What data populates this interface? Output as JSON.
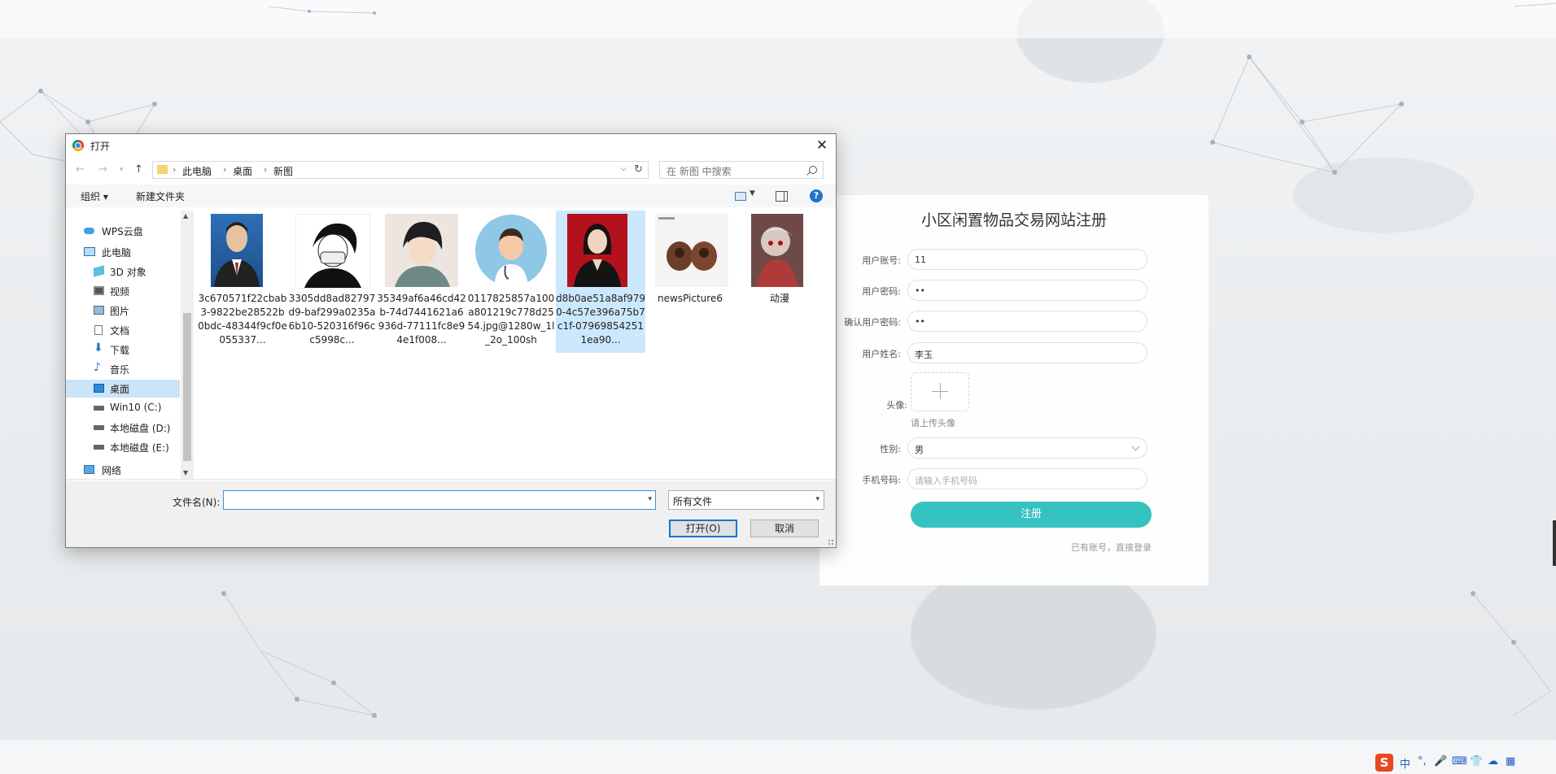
{
  "register": {
    "title": "小区闲置物品交易网站注册",
    "account_label": "用户账号:",
    "account_value": "11",
    "password_label": "用户密码:",
    "password_value": "••",
    "confirm_label": "确认用户密码:",
    "confirm_value": "••",
    "name_label": "用户姓名:",
    "name_value": "李玉",
    "avatar_label": "头像:",
    "avatar_hint": "请上传头像",
    "gender_label": "性别:",
    "gender_value": "男",
    "phone_label": "手机号码:",
    "phone_placeholder": "请输入手机号码",
    "submit_label": "注册",
    "login_link": "已有账号，直接登录"
  },
  "dialog": {
    "title": "打开",
    "breadcrumb": [
      "此电脑",
      "桌面",
      "新图"
    ],
    "search_placeholder": "在 新图 中搜索",
    "toolbar": {
      "organize": "组织 ▾",
      "new_folder": "新建文件夹",
      "help": "?"
    },
    "nav": [
      {
        "label": "WPS云盘",
        "icon": "cloud-icon"
      },
      {
        "label": "此电脑",
        "icon": "computer-icon"
      },
      {
        "label": "3D 对象",
        "icon": "3d-objects-icon"
      },
      {
        "label": "视频",
        "icon": "video-icon"
      },
      {
        "label": "图片",
        "icon": "pictures-icon"
      },
      {
        "label": "文档",
        "icon": "documents-icon"
      },
      {
        "label": "下载",
        "icon": "download-icon"
      },
      {
        "label": "音乐",
        "icon": "music-icon"
      },
      {
        "label": "桌面",
        "icon": "desktop-icon",
        "selected": true
      },
      {
        "label": "Win10 (C:)",
        "icon": "drive-icon"
      },
      {
        "label": "本地磁盘 (D:)",
        "icon": "drive-icon"
      },
      {
        "label": "本地磁盘 (E:)",
        "icon": "drive-icon"
      },
      {
        "label": "网络",
        "icon": "network-icon"
      }
    ],
    "files": [
      {
        "name": "3c670571f22cbab3-9822be28522b0bdc-48344f9cf0e055337...",
        "kind": "id-photo-man"
      },
      {
        "name": "3305dd8ad82797d9-baf299a0235a6b10-520316f96cc5998c...",
        "kind": "anime-mask"
      },
      {
        "name": "35349af6a46cd42b-74d7441621a6936d-77111fc8e94e1f008...",
        "kind": "anime-boy"
      },
      {
        "name": "0117825857a100a801219c778d2554.jpg@1280w_1l_2o_100sh",
        "kind": "doctor-avatar"
      },
      {
        "name": "d8b0ae51a8af9790-4c57e396a75b7c1f-079698542511ea90...",
        "kind": "id-photo-woman",
        "selected": true
      },
      {
        "name": "newsPicture6",
        "kind": "nuts"
      },
      {
        "name": "动漫",
        "kind": "anime-art"
      }
    ],
    "filename_label": "文件名(N):",
    "filename_value": "",
    "filetype_value": "所有文件",
    "open_label": "打开(O)",
    "cancel_label": "取消"
  },
  "tray": {
    "ime": "S",
    "items": [
      "中",
      "°,",
      "🎤",
      "⌨",
      "👕",
      "☁",
      "▦"
    ]
  }
}
